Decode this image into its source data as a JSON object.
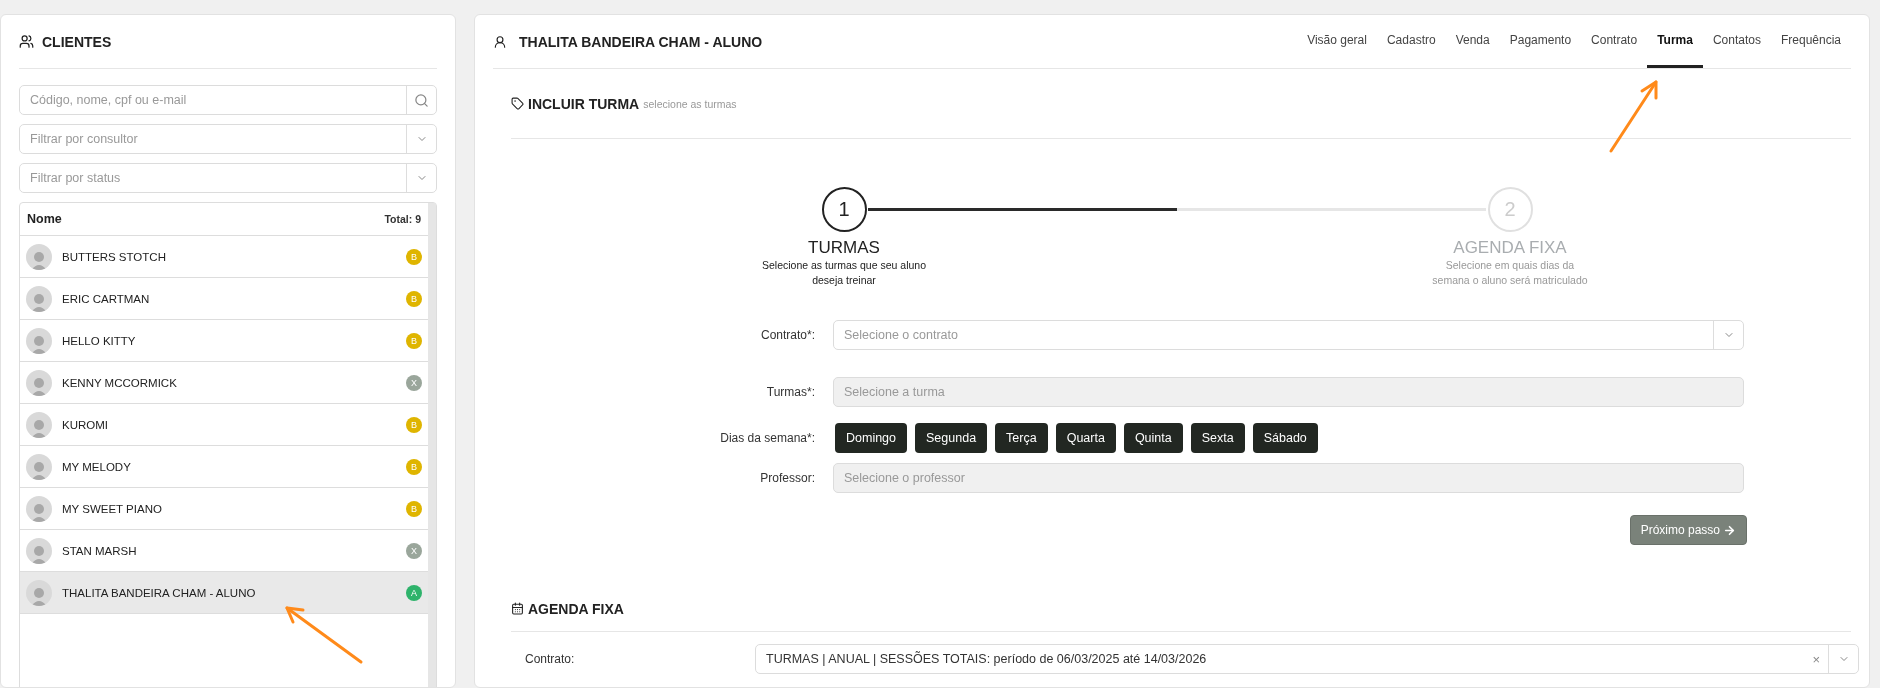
{
  "clients": {
    "title": "CLIENTES",
    "search": {
      "placeholder": "Código, nome, cpf ou e-mail"
    },
    "filters": [
      {
        "placeholder": "Filtrar por consultor"
      },
      {
        "placeholder": "Filtrar por status"
      }
    ],
    "list_header": {
      "name": "Nome",
      "total": "Total: 9"
    },
    "items": [
      {
        "name": "BUTTERS STOTCH",
        "badge": "B",
        "color": "#dfb500",
        "selected": false
      },
      {
        "name": "ERIC CARTMAN",
        "badge": "B",
        "color": "#dfb500",
        "selected": false
      },
      {
        "name": "HELLO KITTY",
        "badge": "B",
        "color": "#dfb500",
        "selected": false
      },
      {
        "name": "KENNY MCCORMICK",
        "badge": "X",
        "color": "#9aa69b",
        "selected": false
      },
      {
        "name": "KUROMI",
        "badge": "B",
        "color": "#dfb500",
        "selected": false
      },
      {
        "name": "MY MELODY",
        "badge": "B",
        "color": "#dfb500",
        "selected": false
      },
      {
        "name": "MY SWEET PIANO",
        "badge": "B",
        "color": "#dfb500",
        "selected": false
      },
      {
        "name": "STAN MARSH",
        "badge": "X",
        "color": "#9aa69b",
        "selected": false
      },
      {
        "name": "THALITA BANDEIRA CHAM - ALUNO",
        "badge": "A",
        "color": "#2eb36b",
        "selected": true
      }
    ]
  },
  "main": {
    "title": "THALITA BANDEIRA CHAM - ALUNO",
    "tabs": [
      {
        "label": "Visão geral",
        "selected": false
      },
      {
        "label": "Cadastro",
        "selected": false
      },
      {
        "label": "Venda",
        "selected": false
      },
      {
        "label": "Pagamento",
        "selected": false
      },
      {
        "label": "Contrato",
        "selected": false
      },
      {
        "label": "Turma",
        "selected": true
      },
      {
        "label": "Contatos",
        "selected": false
      },
      {
        "label": "Frequência",
        "selected": false
      }
    ],
    "section": {
      "title": "INCLUIR TURMA",
      "hint": "selecione as turmas"
    },
    "stepper": {
      "level": 0.5,
      "steps": [
        {
          "number": "1",
          "title": "TURMAS",
          "description": "Selecione as turmas que seu aluno deseja treinar",
          "selected": true
        },
        {
          "number": "2",
          "title": "AGENDA FIXA",
          "description": "Selecione em quais dias da semana o aluno será matriculado",
          "selected": false
        }
      ]
    },
    "form": [
      {
        "kind": "select",
        "label": "Contrato*:",
        "placeholder": "Selecione o contrato",
        "disabled": false
      },
      {
        "kind": "select",
        "label": "Turmas*:",
        "placeholder": "Selecione a turma",
        "disabled": true
      },
      {
        "kind": "days",
        "label": "Dias da semana*:",
        "days": [
          "Domingo",
          "Segunda",
          "Terça",
          "Quarta",
          "Quinta",
          "Sexta",
          "Sábado"
        ]
      },
      {
        "kind": "input",
        "label": "Professor:",
        "placeholder": "Selecione o professor",
        "disabled": true
      }
    ],
    "next_button": "Próximo passo",
    "agenda": {
      "title": "AGENDA FIXA",
      "label": "Contrato:",
      "value": "TURMAS | ANUAL | SESSÕES TOTAIS: período de 06/03/2025 até 14/03/2026",
      "clear": "×"
    }
  }
}
